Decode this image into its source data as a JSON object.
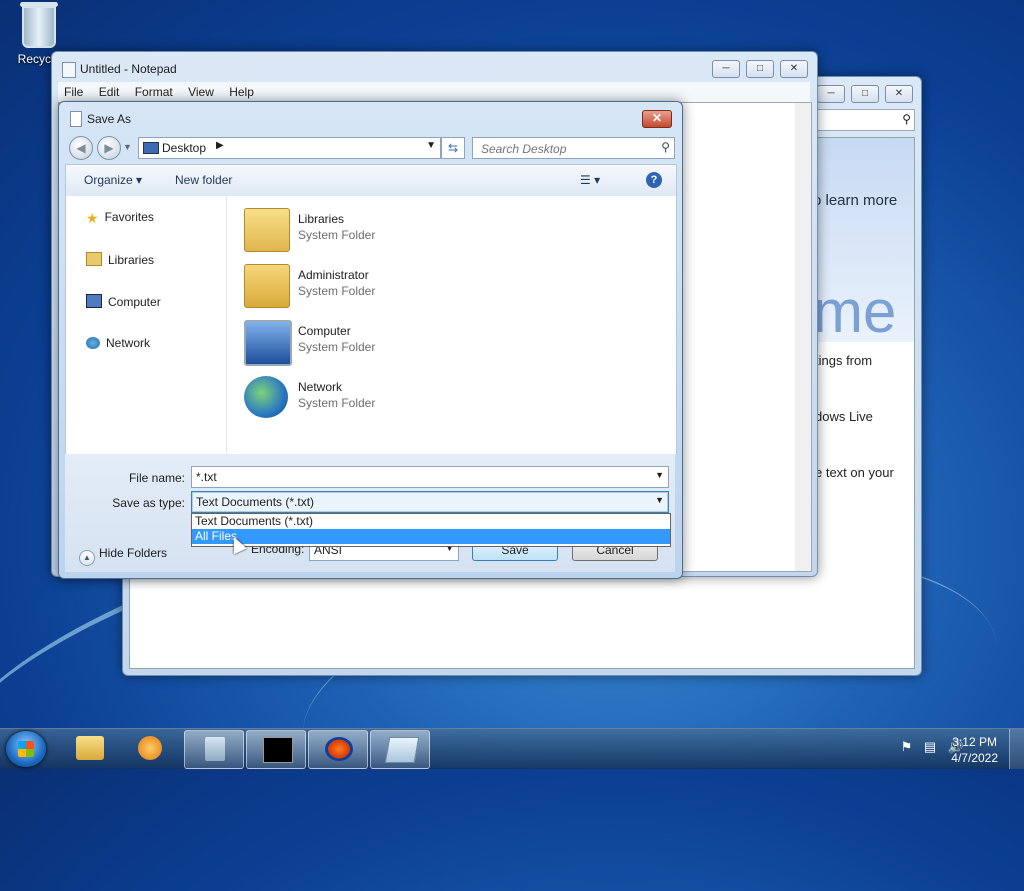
{
  "desktop": {
    "recycle_label": "Recycle"
  },
  "back_window": {
    "text_learn": "o learn more",
    "text_big": "me",
    "text_line1": "tings from",
    "text_line2": "dows Live",
    "text_line3": "e text on your"
  },
  "notepad": {
    "title": "Untitled - Notepad",
    "menu": [
      "File",
      "Edit",
      "Format",
      "View",
      "Help"
    ]
  },
  "dialog": {
    "title": "Save As",
    "address": "Desktop",
    "search_placeholder": "Search Desktop",
    "toolbar": {
      "organize": "Organize",
      "new_folder": "New folder"
    },
    "nav": [
      "Favorites",
      "Libraries",
      "Computer",
      "Network"
    ],
    "items": [
      {
        "name": "Libraries",
        "type": "System Folder"
      },
      {
        "name": "Administrator",
        "type": "System Folder"
      },
      {
        "name": "Computer",
        "type": "System Folder"
      },
      {
        "name": "Network",
        "type": "System Folder"
      }
    ],
    "file_name_label": "File name:",
    "file_name_value": "*.txt",
    "save_type_label": "Save as type:",
    "save_type_value": "Text Documents (*.txt)",
    "type_options": [
      "Text Documents (*.txt)",
      "All Files"
    ],
    "selected_option": "All Files",
    "encoding_label": "Encoding:",
    "encoding_value": "ANSI",
    "save_button": "Save",
    "cancel_button": "Cancel",
    "hide_folders": "Hide Folders"
  },
  "taskbar": {
    "clock_time": "3:12 PM",
    "clock_date": "4/7/2022"
  },
  "colors": {
    "selection": "#3399ff",
    "start_orb": "#1d6bc4"
  }
}
